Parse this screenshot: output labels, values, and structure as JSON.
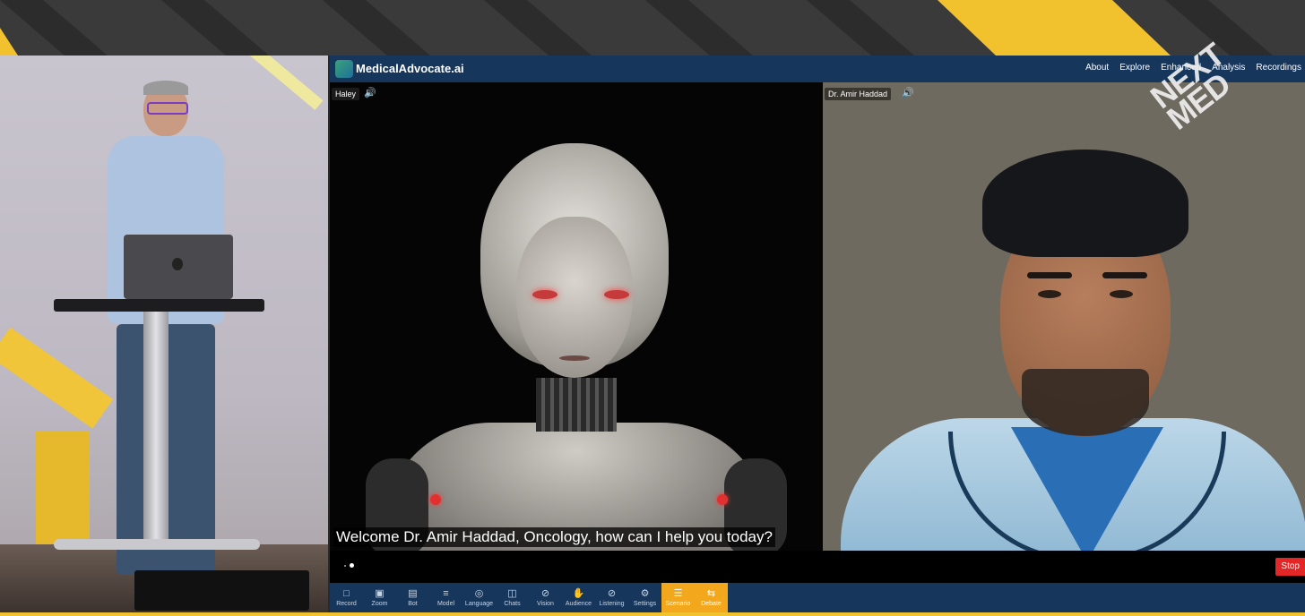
{
  "app": {
    "title": "MedicalAdvocate.ai",
    "nav": [
      "About",
      "Explore",
      "Enhanced",
      "Analysis",
      "Recordings"
    ]
  },
  "panes": {
    "left": {
      "name": "Haley",
      "caption": "Welcome Dr. Amir Haddad, Oncology, how can I help you today?"
    },
    "right": {
      "name": "Dr. Amir Haddad"
    }
  },
  "badge": {
    "text": "NEXT MED"
  },
  "controls": {
    "stop_label": "Stop"
  },
  "toolbar": {
    "items": [
      {
        "label": "Record",
        "icon": "video-icon"
      },
      {
        "label": "Zoom",
        "icon": "zoom-icon"
      },
      {
        "label": "Bot",
        "icon": "bot-icon"
      },
      {
        "label": "Model",
        "icon": "sliders-icon"
      },
      {
        "label": "Language",
        "icon": "globe-icon"
      },
      {
        "label": "Chats",
        "icon": "chat-icon"
      },
      {
        "label": "Vision",
        "icon": "eye-off-icon"
      },
      {
        "label": "Audience",
        "icon": "hand-icon"
      },
      {
        "label": "Listening",
        "icon": "ear-off-icon"
      },
      {
        "label": "Settings",
        "icon": "gear-icon"
      },
      {
        "label": "Scenario",
        "icon": "checklist-icon",
        "active": true
      },
      {
        "label": "Debate",
        "icon": "debate-icon",
        "active": true
      }
    ]
  },
  "colors": {
    "topbar": "#17365c",
    "accent": "#f2a71c",
    "stop": "#e32626"
  }
}
